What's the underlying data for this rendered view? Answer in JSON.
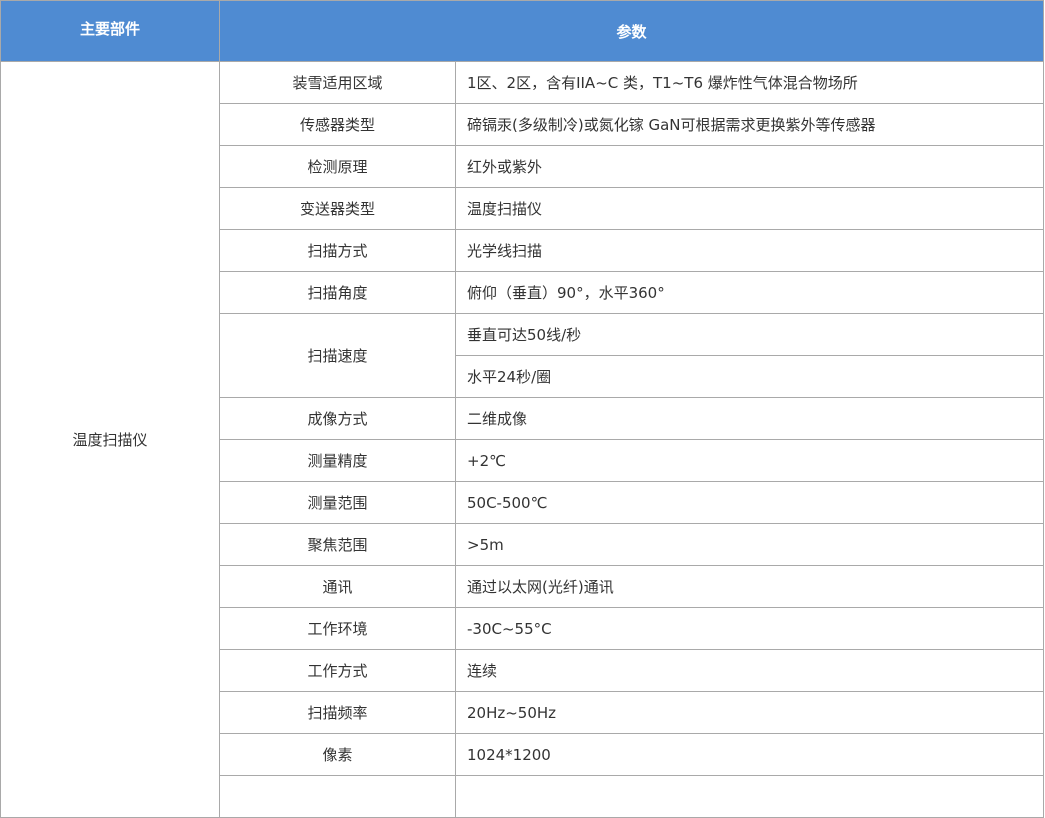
{
  "header": {
    "main_component": "主要部件",
    "parameters": "参数"
  },
  "component": "温度扫描仪",
  "rows": [
    {
      "param": "装雪适用区域",
      "values": [
        "1区、2区，含有IIA~C 类，T1~T6 爆炸性气体混合物场所"
      ]
    },
    {
      "param": "传感器类型",
      "values": [
        "碲镉汞(多级制冷)或氮化镓 GaN可根据需求更换紫外等传感器"
      ]
    },
    {
      "param": "检测原理",
      "values": [
        "红外或紫外"
      ]
    },
    {
      "param": "变送器类型",
      "values": [
        "温度扫描仪"
      ]
    },
    {
      "param": "扫描方式",
      "values": [
        "光学线扫描"
      ]
    },
    {
      "param": "扫描角度",
      "values": [
        "俯仰（垂直）90°，水平360°"
      ]
    },
    {
      "param": "扫描速度",
      "values": [
        "垂直可达50线/秒",
        "水平24秒/圈"
      ]
    },
    {
      "param": "成像方式",
      "values": [
        "二维成像"
      ]
    },
    {
      "param": "测量精度",
      "values": [
        "+2℃"
      ]
    },
    {
      "param": "测量范围",
      "values": [
        "50C-500℃"
      ]
    },
    {
      "param": "聚焦范围",
      "values": [
        ">5m"
      ]
    },
    {
      "param": "通讯",
      "values": [
        "通过以太网(光纤)通讯"
      ]
    },
    {
      "param": "工作环境",
      "values": [
        "-30C~55°C"
      ]
    },
    {
      "param": "工作方式",
      "values": [
        "连续"
      ]
    },
    {
      "param": "扫描频率",
      "values": [
        "20Hz~50Hz"
      ]
    },
    {
      "param": "像素",
      "values": [
        "1024*1200"
      ]
    },
    {
      "param": "",
      "values": [
        ""
      ]
    }
  ]
}
